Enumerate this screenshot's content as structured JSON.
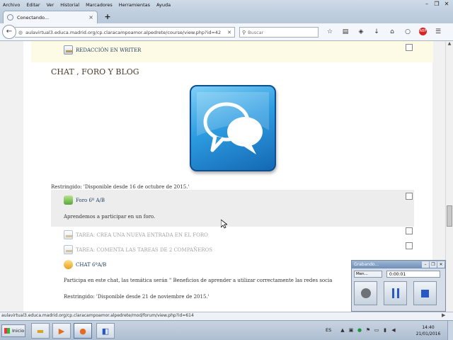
{
  "menubar": {
    "items": [
      "Archivo",
      "Editar",
      "Ver",
      "Historial",
      "Marcadores",
      "Herramientas",
      "Ayuda"
    ]
  },
  "tab": {
    "title": "Conectando...",
    "close": "×"
  },
  "newtab": "+",
  "nav": {
    "url": "aulavirtual3.educa.madrid.org/cp.claracampoamor.alpedrete/course/view.php?id=42",
    "search_placeholder": "Buscar"
  },
  "page": {
    "top_item": "REDACCIÓN EN WRITER",
    "section_title": "CHAT , FORO Y BLOG",
    "restricted_1": "Restringido: 'Disponible desde 16 de octubre de 2015.'",
    "forum_link": "Foro 6º A/B",
    "forum_desc": "Aprendemos a participar en un foro.",
    "task1": "TAREA: CREA UNA NUEVA ENTRADA EN EL FORO",
    "task2": "TAREA: COMENTA LAS TAREAS DE 2 COMPAÑEROS",
    "chat_link": "CHAT 6ºA/B",
    "chat_desc": "Participa en este chat, las temática serán \" Beneficios de aprender a utilizar correctamente las redes socia",
    "restricted_2": "Restringido: 'Disponible desde 21 de noviembre de 2015.'"
  },
  "status_url": "aulavirtual3.educa.madrid.org/cp.claracampoamor.alpedrete/mod/forum/view.php?id=614",
  "recorder": {
    "title": "Grabando...",
    "select_value": "Men...",
    "time": "0:00:01"
  },
  "taskbar": {
    "start": "Inicio",
    "lang": "ES",
    "time": "14:40",
    "date": "21/01/2016"
  },
  "colors": {
    "link": "#1f3f63",
    "dim": "#a4a4a4",
    "section_title": "#4a3a2a",
    "logo_blue": "#2d9ce1"
  }
}
